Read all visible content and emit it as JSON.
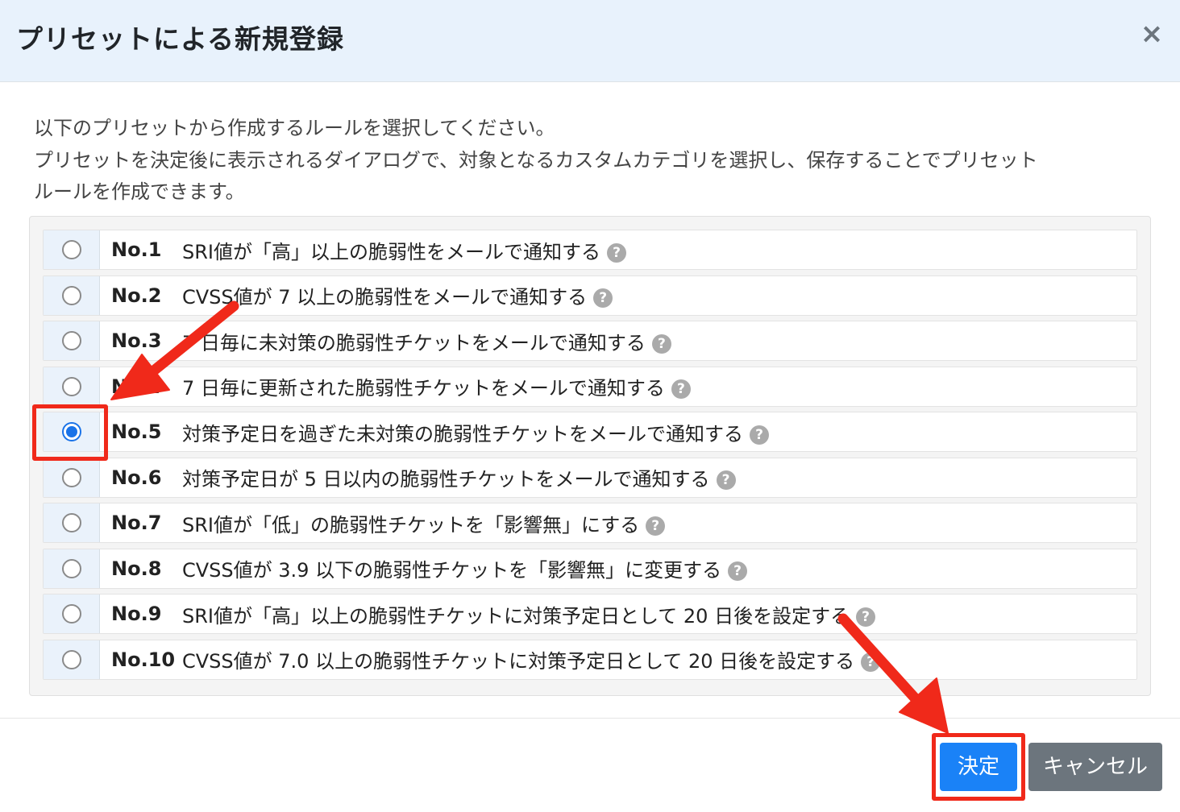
{
  "header": {
    "title": "プリセットによる新規登録",
    "close_label": "×"
  },
  "intro": {
    "line1": "以下のプリセットから作成するルールを選択してください。",
    "line2": "プリセットを決定後に表示されるダイアログで、対象となるカスタムカテゴリを選択し、保存することでプリセット",
    "line3": "ルールを作成できます。"
  },
  "presets": [
    {
      "no": "No.1",
      "text": "SRI値が「高」以上の脆弱性をメールで通知する",
      "selected": false
    },
    {
      "no": "No.2",
      "text": "CVSS値が 7 以上の脆弱性をメールで通知する",
      "selected": false
    },
    {
      "no": "No.3",
      "text": "7 日毎に未対策の脆弱性チケットをメールで通知する",
      "selected": false
    },
    {
      "no": "No.4",
      "text": "7 日毎に更新された脆弱性チケットをメールで通知する",
      "selected": false
    },
    {
      "no": "No.5",
      "text": "対策予定日を過ぎた未対策の脆弱性チケットをメールで通知する",
      "selected": true
    },
    {
      "no": "No.6",
      "text": "対策予定日が 5 日以内の脆弱性チケットをメールで通知する",
      "selected": false
    },
    {
      "no": "No.7",
      "text": "SRI値が「低」の脆弱性チケットを「影響無」にする",
      "selected": false
    },
    {
      "no": "No.8",
      "text": "CVSS値が 3.9 以下の脆弱性チケットを「影響無」に変更する",
      "selected": false
    },
    {
      "no": "No.9",
      "text": "SRI値が「高」以上の脆弱性チケットに対策予定日として 20 日後を設定する",
      "selected": false
    },
    {
      "no": "No.10",
      "text": "CVSS値が 7.0 以上の脆弱性チケットに対策予定日として 20 日後を設定する",
      "selected": false
    }
  ],
  "help_icon_glyph": "?",
  "footer": {
    "confirm_label": "決定",
    "cancel_label": "キャンセル"
  },
  "colors": {
    "primary": "#1a82f7",
    "secondary": "#6c757d",
    "annotation": "#f0291a",
    "header_bg": "#e8f2fc"
  }
}
